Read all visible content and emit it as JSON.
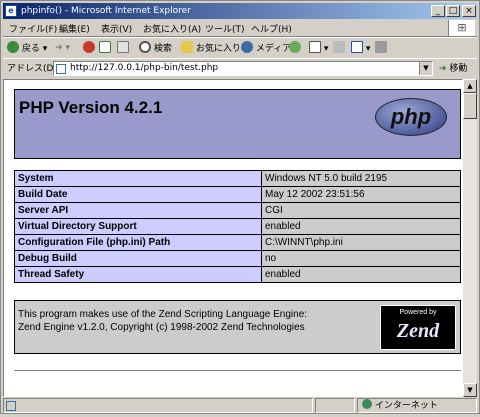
{
  "window": {
    "title": "phpinfo() - Microsoft Internet Explorer",
    "buttons": {
      "minimize": "_",
      "maximize": "□",
      "close": "×"
    }
  },
  "menu": {
    "items": [
      "ファイル(F)",
      "編集(E)",
      "表示(V)",
      "お気に入り(A)",
      "ツール(T)",
      "ヘルプ(H)"
    ]
  },
  "toolbar": {
    "back_label": "戻る",
    "search_label": "検索",
    "favorites_label": "お気に入り",
    "media_label": "メディア"
  },
  "address": {
    "label": "アドレス(D)",
    "url": "http://127.0.0.1/php-bin/test.php",
    "go_label": "移動"
  },
  "page": {
    "heading": "PHP Version 4.2.1",
    "logo_text": "php",
    "info_rows": [
      {
        "name": "System",
        "value": "Windows NT 5.0 build 2195"
      },
      {
        "name": "Build Date",
        "value": "May 12 2002 23:51:56"
      },
      {
        "name": "Server API",
        "value": "CGI"
      },
      {
        "name": "Virtual Directory Support",
        "value": "enabled"
      },
      {
        "name": "Configuration File (php.ini) Path",
        "value": "C:\\WINNT\\php.ini"
      },
      {
        "name": "Debug Build",
        "value": "no"
      },
      {
        "name": "Thread Safety",
        "value": "enabled"
      }
    ],
    "zend_line1": "This program makes use of the Zend Scripting Language Engine:",
    "zend_line2": "Zend Engine v1.2.0, Copyright (c) 1998-2002 Zend Technologies",
    "zend_logo_top": "Powered by",
    "zend_logo_text": "Zend"
  },
  "status": {
    "zone": "インターネット"
  },
  "colors": {
    "header_bg": "#9999cc",
    "label_cell": "#ccccff",
    "value_cell": "#cccccc",
    "title_bar": "#0a246a"
  }
}
